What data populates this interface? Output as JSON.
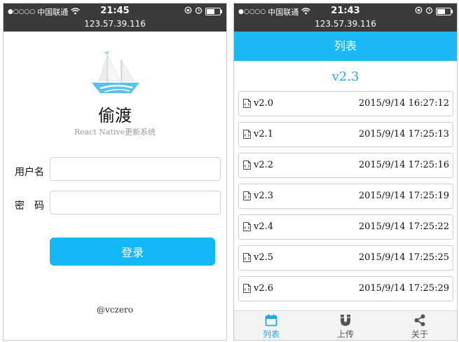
{
  "status_bar": {
    "carrier": "中国联通",
    "url": "123.57.39.116"
  },
  "login_screen": {
    "time": "21:45",
    "app_name": "偷渡",
    "subtitle": "React Native更新系统",
    "username_label": "用户名",
    "password_label": "密　码",
    "username_value": "",
    "password_value": "",
    "login_button": "登录",
    "footer": "@vczero"
  },
  "list_screen": {
    "time": "21:43",
    "nav_title": "列表",
    "current_version": "v2.3",
    "items": [
      {
        "version": "v2.0",
        "date": "2015/9/14 16:27:12"
      },
      {
        "version": "v2.1",
        "date": "2015/9/14 17:25:13"
      },
      {
        "version": "v2.2",
        "date": "2015/9/14 17:25:16"
      },
      {
        "version": "v2.3",
        "date": "2015/9/14 17:25:19"
      },
      {
        "version": "v2.4",
        "date": "2015/9/14 17:25:22"
      },
      {
        "version": "v2.5",
        "date": "2015/9/14 17:25:25"
      },
      {
        "version": "v2.6",
        "date": "2015/9/14 17:25:29"
      }
    ],
    "tabs": [
      {
        "label": "列表",
        "icon": "calendar-icon",
        "active": true
      },
      {
        "label": "上传",
        "icon": "magnet-icon",
        "active": false
      },
      {
        "label": "关于",
        "icon": "share-icon",
        "active": false
      }
    ]
  },
  "colors": {
    "accent": "#14b7f7",
    "status_bar_bg": "#3a3a3a",
    "version_title": "#1cb0e8"
  }
}
